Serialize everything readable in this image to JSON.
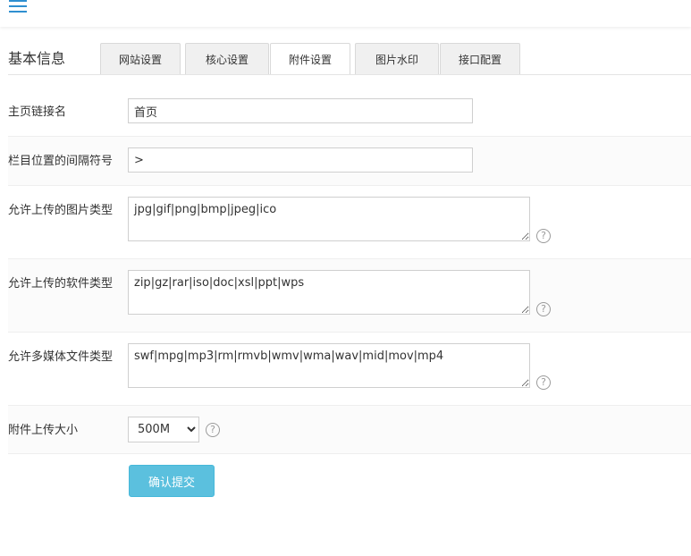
{
  "header": {
    "menu_icon": "hamburger-menu-icon"
  },
  "section": {
    "title": "基本信息"
  },
  "tabs": [
    {
      "label": "网站设置",
      "active": false
    },
    {
      "label": "核心设置",
      "active": false
    },
    {
      "label": "附件设置",
      "active": true
    },
    {
      "label": "图片水印",
      "active": false
    },
    {
      "label": "接口配置",
      "active": false
    }
  ],
  "form": {
    "home_link_name": {
      "label": "主页链接名",
      "value": "首页"
    },
    "separator": {
      "label": "栏目位置的间隔符号",
      "value": ">"
    },
    "image_types": {
      "label": "允许上传的图片类型",
      "value": "jpg|gif|png|bmp|jpeg|ico"
    },
    "software_types": {
      "label": "允许上传的软件类型",
      "value": "zip|gz|rar|iso|doc|xsl|ppt|wps"
    },
    "media_types": {
      "label": "允许多媒体文件类型",
      "value": "swf|mpg|mp3|rm|rmvb|wmv|wma|wav|mid|mov|mp4"
    },
    "upload_size": {
      "label": "附件上传大小",
      "selected": "500M"
    },
    "help_icon": "question-circle-icon",
    "submit_label": "确认提交"
  },
  "colors": {
    "accent": "#5bc0de",
    "menu": "#2f8fd0"
  }
}
